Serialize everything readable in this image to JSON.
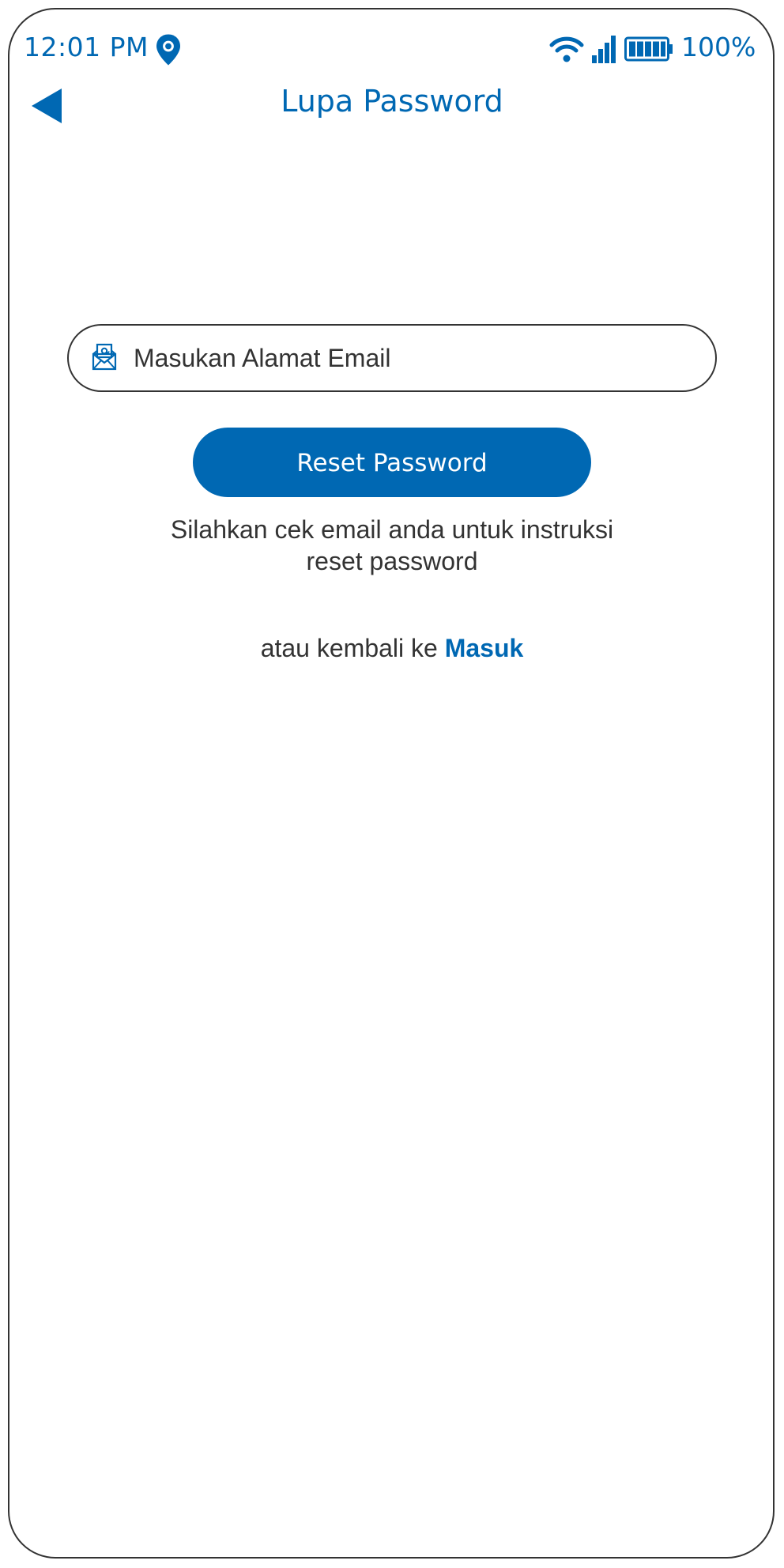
{
  "status_bar": {
    "time": "12:01 PM",
    "battery_percent": "100%",
    "icons": [
      "location-icon",
      "wifi-icon",
      "signal-icon",
      "battery-icon"
    ]
  },
  "header": {
    "back_icon": "back-arrow-icon",
    "title": "Lupa Password"
  },
  "form": {
    "email_icon": "email-icon",
    "email_placeholder": "Masukan Alamat Email",
    "email_value": "",
    "reset_button_label": "Reset Password",
    "info_line1": "Silahkan cek email anda untuk instruksi",
    "info_line2": "reset password",
    "back_prefix": "atau kembali ke ",
    "login_link_label": "Masuk"
  },
  "colors": {
    "accent": "#0068b3",
    "text": "#333333",
    "background": "#ffffff"
  }
}
